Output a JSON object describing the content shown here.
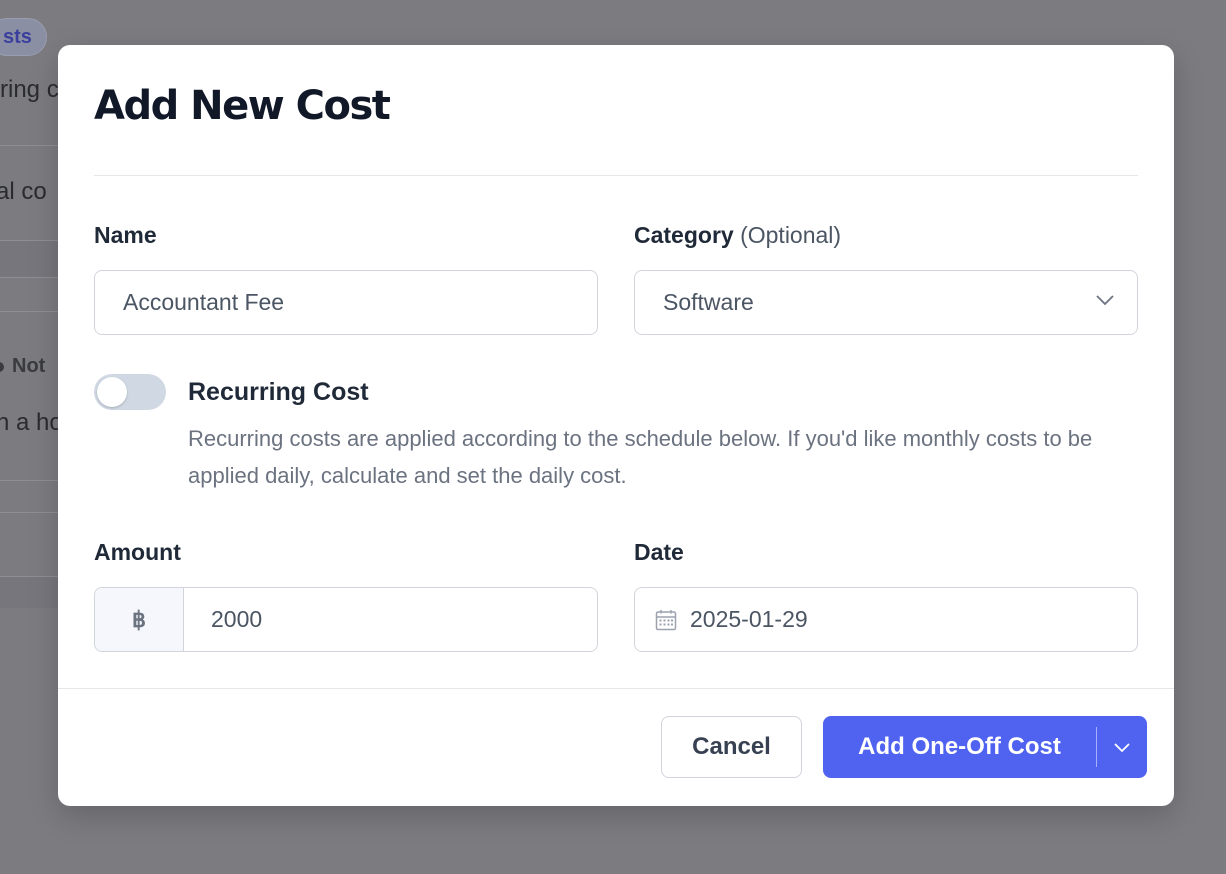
{
  "background": {
    "badge": "sts",
    "line1": "ring c",
    "line2": "al co",
    "status": "Not",
    "line4": "n a ho"
  },
  "modal": {
    "title": "Add New Cost",
    "name": {
      "label": "Name",
      "value": "Accountant Fee"
    },
    "category": {
      "label": "Category",
      "optional": "(Optional)",
      "value": "Software"
    },
    "recurring": {
      "title": "Recurring Cost",
      "description": "Recurring costs are applied according to the schedule below. If you'd like monthly costs to be applied daily, calculate and set the daily cost.",
      "enabled": false
    },
    "amount": {
      "label": "Amount",
      "currency": "฿",
      "value": "2000"
    },
    "date": {
      "label": "Date",
      "value": "2025-01-29"
    },
    "buttons": {
      "cancel": "Cancel",
      "primary": "Add One-Off Cost"
    }
  },
  "colors": {
    "primary": "#4f63f0",
    "toggle_off": "#cfd8e3",
    "overlay": "#7b7b80"
  },
  "icons": {
    "select": "chevron-down-icon",
    "date": "calendar-icon",
    "split": "chevron-down-icon"
  }
}
